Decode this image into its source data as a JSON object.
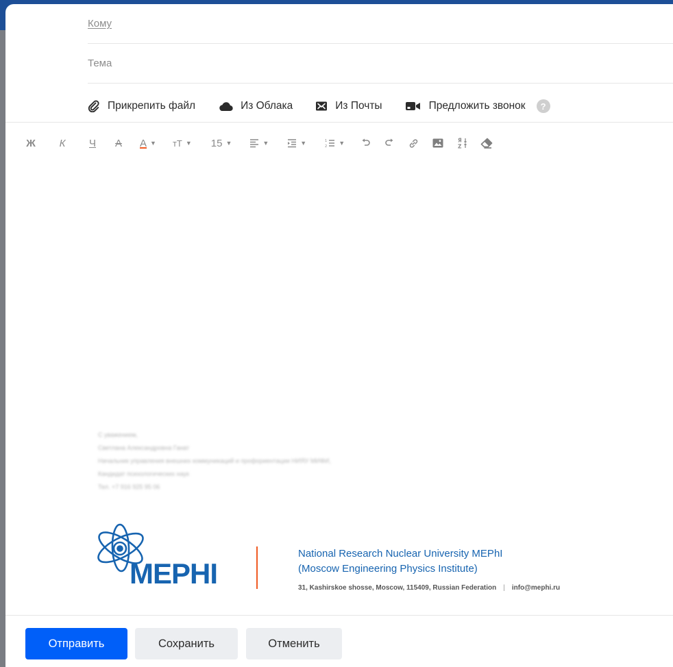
{
  "compose": {
    "to_label": "Кому",
    "to_value": "",
    "subject_label": "Тема",
    "subject_value": ""
  },
  "attach_bar": {
    "attach_file": "Прикрепить файл",
    "from_cloud": "Из Облака",
    "from_mail": "Из Почты",
    "suggest_call": "Предложить звонок",
    "help_icon": "?"
  },
  "toolbar": {
    "bold": "Ж",
    "italic": "К",
    "underline": "Ч",
    "strikethrough": "А",
    "text_color": "A",
    "font_size_icon": "тТ",
    "font_size_value": "15",
    "icons": [
      "bold-icon",
      "italic-icon",
      "underline-icon",
      "strikethrough-icon",
      "text-color-icon",
      "font-size-icon",
      "align-icon",
      "indent-icon",
      "list-icon",
      "undo-icon",
      "redo-icon",
      "link-icon",
      "image-icon",
      "translit-icon",
      "eraser-icon"
    ]
  },
  "signature": {
    "lines": [
      "С уважением,",
      "Светлана Александровна Ганат",
      "Начальник управления внешних коммуникаций и профориентации НИЯУ МИФИ,",
      "Кандидат психологических наук",
      "Тел. +7 916 925 95 06"
    ]
  },
  "logo": {
    "wordmark": "MEPHI",
    "org_line1": "National Research Nuclear University MEPhI",
    "org_line2": "(Moscow Engineering Physics Institute)",
    "address": "31, Kashirskoe shosse, Moscow, 115409, Russian Federation",
    "pipe": "|",
    "email": "info@mephi.ru"
  },
  "footer": {
    "send": "Отправить",
    "save": "Сохранить",
    "cancel": "Отменить"
  },
  "colors": {
    "accent": "#005ff9",
    "brand_blue": "#1764b0",
    "brand_orange": "#f05a22",
    "secondary_button": "#eceef1"
  }
}
